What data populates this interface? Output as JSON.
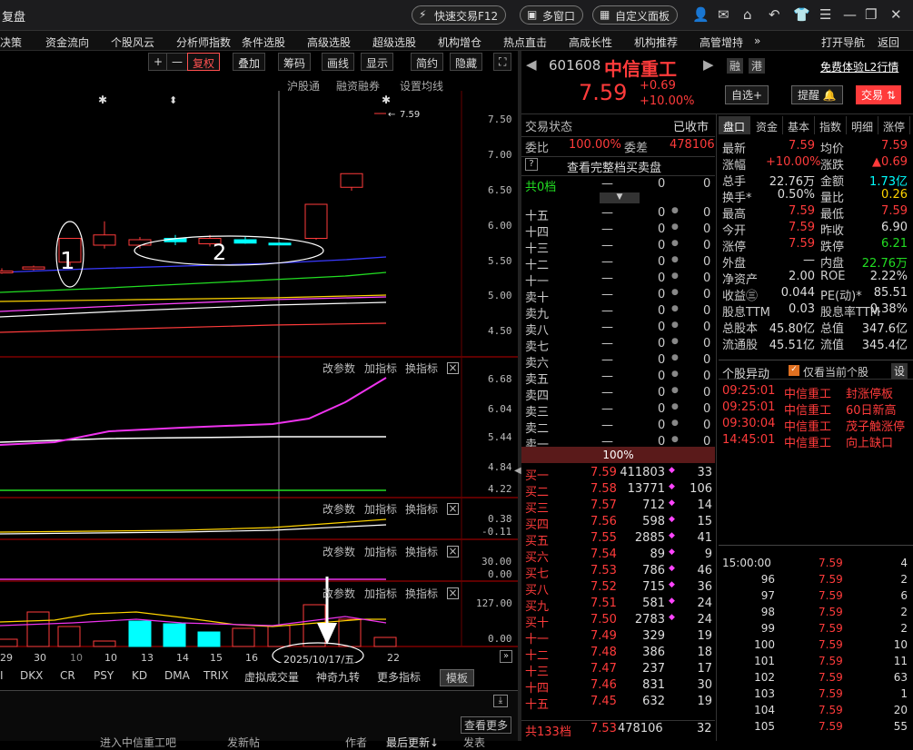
{
  "app": {
    "title": "复盘",
    "quick_trade": "快速交易F12",
    "multi_window": "多窗口",
    "custom_panel": "自定义面板"
  },
  "menu": [
    "决策",
    "资金流向",
    "个股风云",
    "分析师指数",
    "条件选股",
    "高级选股",
    "超级选股",
    "机构增仓",
    "热点直击",
    "高成长性",
    "机构推荐",
    "高管增持",
    "»",
    "打开导航",
    "返回"
  ],
  "chart_toolbar": {
    "plus": "+",
    "minus": "—",
    "restore": "复权",
    "overlay": "叠加",
    "chips": "筹码",
    "draw": "画线",
    "display": "显示",
    "simple": "简约",
    "hide": "隐藏"
  },
  "sub_tabs": [
    "沪股通",
    "融资融券",
    "设置均线"
  ],
  "panel_links": {
    "params": "改参数",
    "add": "加指标",
    "switch": "换指标",
    "close": "×"
  },
  "annotations": {
    "one": "1",
    "two": "2",
    "price_tag": "7.59",
    "date": "2025/10/17/五"
  },
  "main_axis": [
    "7.50",
    "7.00",
    "6.50",
    "6.00",
    "5.50",
    "5.00",
    "4.50"
  ],
  "ind1_axis": [
    "6.68",
    "6.04",
    "5.44",
    "4.84",
    "4.22"
  ],
  "ind2_axis": [
    "0.38",
    "-0.11"
  ],
  "ind3_axis": [
    "30.00",
    "0.00"
  ],
  "ind4_axis": [
    "127.00",
    "0.00"
  ],
  "dates": [
    "29",
    "30",
    "10",
    "10",
    "13",
    "14",
    "15",
    "16",
    "22"
  ],
  "bottom_tabs": [
    "I",
    "DKX",
    "CR",
    "PSY",
    "KD",
    "DMA",
    "TRIX",
    "虚拟成交量",
    "神奇九转",
    "更多指标",
    "模板"
  ],
  "bottom_bar": {
    "view_more": "查看更多",
    "a": "进入中信重工吧",
    "b": "发新帖",
    "c": "作者",
    "d": "最后更新↓",
    "e": "发表"
  },
  "chart_data": {
    "type": "candlestick",
    "candles": [
      {
        "o": 5.3,
        "c": 5.32,
        "h": 5.36,
        "l": 5.28,
        "color": "red"
      },
      {
        "o": 5.35,
        "c": 5.38,
        "h": 5.4,
        "l": 5.33,
        "color": "red"
      },
      {
        "o": 5.45,
        "c": 5.8,
        "h": 5.8,
        "l": 5.4,
        "color": "red"
      },
      {
        "o": 5.7,
        "c": 5.85,
        "h": 6.05,
        "l": 5.65,
        "color": "red"
      },
      {
        "o": 5.7,
        "c": 5.78,
        "h": 5.82,
        "l": 5.65,
        "color": "red"
      },
      {
        "o": 5.75,
        "c": 5.8,
        "h": 5.85,
        "l": 5.7,
        "color": "cyan"
      },
      {
        "o": 5.72,
        "c": 5.8,
        "h": 5.85,
        "l": 5.68,
        "color": "red"
      },
      {
        "o": 5.73,
        "c": 5.78,
        "h": 5.82,
        "l": 5.72,
        "color": "cyan"
      },
      {
        "o": 5.72,
        "c": 5.73,
        "h": 5.74,
        "l": 5.7,
        "color": "cyan"
      },
      {
        "o": 5.8,
        "c": 6.3,
        "h": 6.3,
        "l": 5.78,
        "color": "red"
      },
      {
        "o": 6.55,
        "c": 6.75,
        "h": 6.75,
        "l": 6.5,
        "color": "red"
      }
    ],
    "ylim": [
      4.3,
      7.7
    ]
  },
  "stock": {
    "code": "601608",
    "name": "中信重工",
    "price": "7.59",
    "change": "+0.69",
    "pct": "+10.00%",
    "rong": "融",
    "gang": "港",
    "l2": "免费体验L2行情",
    "watch": "自选+",
    "remind": "提醒",
    "trade": "交易"
  },
  "order_book": {
    "status_label": "交易状态",
    "status": "已收市",
    "ratio_label": "委比",
    "ratio": "100.00%",
    "diff_label": "委差",
    "diff": "478106",
    "full": "查看完整档买卖盘",
    "total0": "共0档",
    "dash": "—",
    "zero": "0",
    "sells": [
      "十五",
      "十四",
      "十三",
      "十二",
      "十一",
      "卖十",
      "卖九",
      "卖八",
      "卖七",
      "卖六",
      "卖五",
      "卖四",
      "卖三",
      "卖二",
      "卖一"
    ],
    "pct_bar": "100%",
    "buys": [
      {
        "n": "买一",
        "p": "7.59",
        "v": "411803",
        "c": "33"
      },
      {
        "n": "买二",
        "p": "7.58",
        "v": "13771",
        "c": "106"
      },
      {
        "n": "买三",
        "p": "7.57",
        "v": "712",
        "c": "14"
      },
      {
        "n": "买四",
        "p": "7.56",
        "v": "598",
        "c": "15"
      },
      {
        "n": "买五",
        "p": "7.55",
        "v": "2885",
        "c": "41"
      },
      {
        "n": "买六",
        "p": "7.54",
        "v": "89",
        "c": "9"
      },
      {
        "n": "买七",
        "p": "7.53",
        "v": "786",
        "c": "46"
      },
      {
        "n": "买八",
        "p": "7.52",
        "v": "715",
        "c": "36"
      },
      {
        "n": "买九",
        "p": "7.51",
        "v": "581",
        "c": "24"
      },
      {
        "n": "买十",
        "p": "7.50",
        "v": "2783",
        "c": "24"
      },
      {
        "n": "十一",
        "p": "7.49",
        "v": "329",
        "c": "19"
      },
      {
        "n": "十二",
        "p": "7.48",
        "v": "386",
        "c": "18"
      },
      {
        "n": "十三",
        "p": "7.47",
        "v": "237",
        "c": "17"
      },
      {
        "n": "十四",
        "p": "7.46",
        "v": "831",
        "c": "30"
      },
      {
        "n": "十五",
        "p": "7.45",
        "v": "632",
        "c": "19"
      }
    ],
    "total": {
      "n": "共133档",
      "p": "7.53",
      "v": "478106",
      "c": "32"
    }
  },
  "quote_tabs": [
    "盘口",
    "资金",
    "基本",
    "指数",
    "明细",
    "涨停"
  ],
  "quote": [
    [
      "最新",
      "7.59",
      "均价",
      "7.59"
    ],
    [
      "涨幅",
      "+10.00%",
      "涨跌",
      "▲0.69"
    ],
    [
      "总手",
      "22.76万",
      "金额",
      "1.73亿"
    ],
    [
      "换手*",
      "0.50%",
      "量比",
      "0.26"
    ],
    [
      "最高",
      "7.59",
      "最低",
      "7.59"
    ],
    [
      "今开",
      "7.59",
      "昨收",
      "6.90"
    ],
    [
      "涨停",
      "7.59",
      "跌停",
      "6.21"
    ],
    [
      "外盘",
      "—",
      "内盘",
      "22.76万"
    ],
    [
      "净资产",
      "2.00",
      "ROE",
      "2.22%"
    ],
    [
      "收益㊂",
      "0.044",
      "PE(动)*",
      "85.51"
    ],
    [
      "股息TTM",
      "0.03",
      "股息率TTM",
      "0.38%"
    ],
    [
      "总股本",
      "45.80亿",
      "总值",
      "347.6亿"
    ],
    [
      "流通股",
      "45.51亿",
      "流值",
      "345.4亿"
    ]
  ],
  "alerts": {
    "title": "个股异动",
    "only_current": "仅看当前个股",
    "settings": "设",
    "items": [
      {
        "t": "09:25:01",
        "n": "中信重工",
        "e": "封涨停板"
      },
      {
        "t": "09:25:01",
        "n": "中信重工",
        "e": "60日新高"
      },
      {
        "t": "09:30:04",
        "n": "中信重工",
        "e": "茂子触涨停"
      },
      {
        "t": "14:45:01",
        "n": "中信重工",
        "e": "向上缺口"
      }
    ]
  },
  "ticks": [
    {
      "t": "15:00:00",
      "p": "7.59",
      "v": "4"
    },
    {
      "t": "96",
      "p": "7.59",
      "v": "2"
    },
    {
      "t": "97",
      "p": "7.59",
      "v": "6"
    },
    {
      "t": "98",
      "p": "7.59",
      "v": "2"
    },
    {
      "t": "99",
      "p": "7.59",
      "v": "2"
    },
    {
      "t": "100",
      "p": "7.59",
      "v": "10"
    },
    {
      "t": "101",
      "p": "7.59",
      "v": "11"
    },
    {
      "t": "102",
      "p": "7.59",
      "v": "63"
    },
    {
      "t": "103",
      "p": "7.59",
      "v": "1"
    },
    {
      "t": "104",
      "p": "7.59",
      "v": "20"
    },
    {
      "t": "105",
      "p": "7.59",
      "v": "55"
    }
  ]
}
